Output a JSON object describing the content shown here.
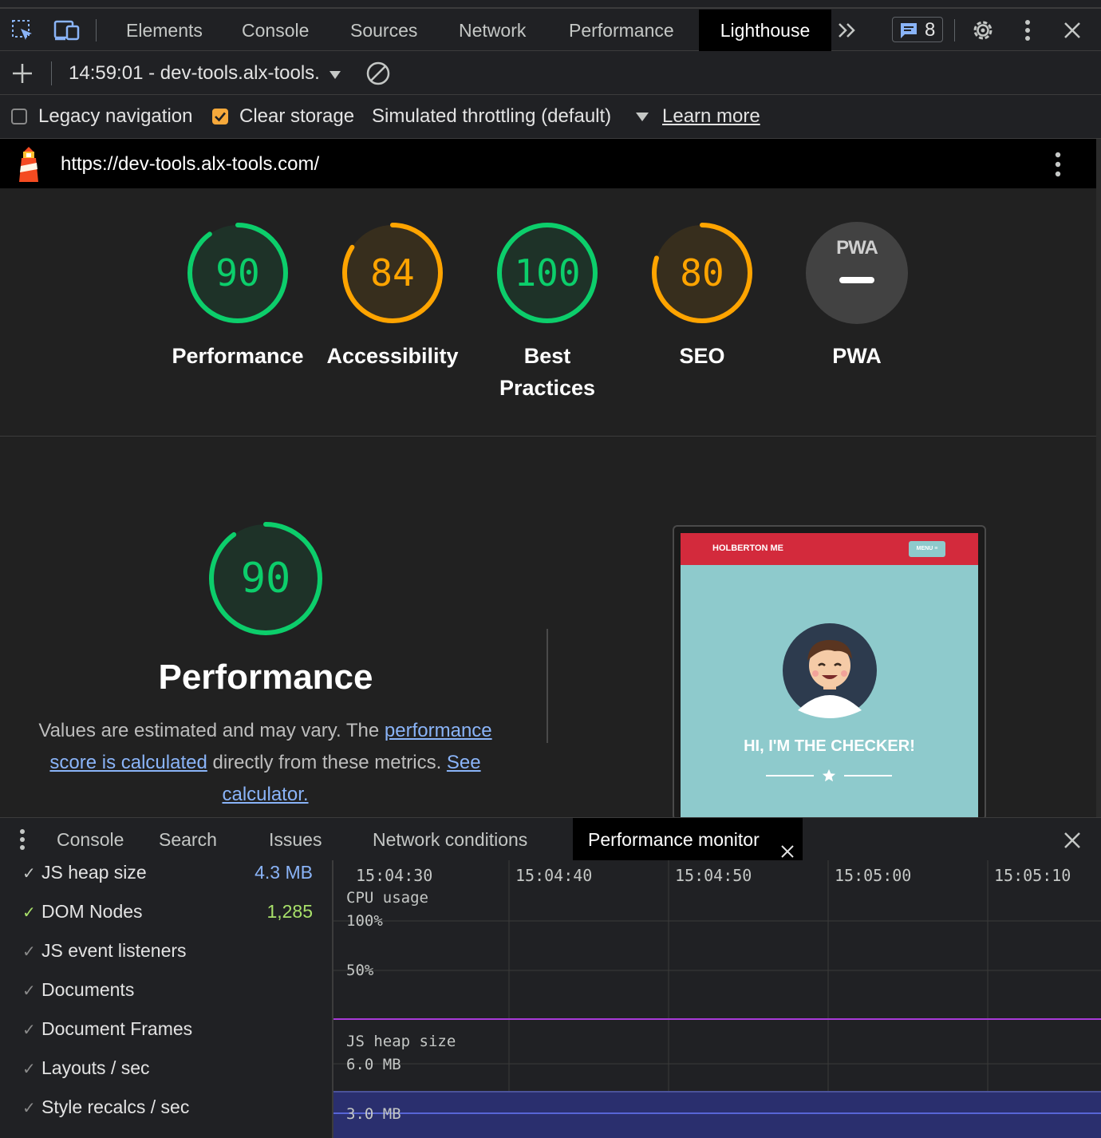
{
  "tabs": [
    "Elements",
    "Console",
    "Sources",
    "Network",
    "Performance",
    "Lighthouse"
  ],
  "active_tab": "Lighthouse",
  "issues_badge": "8",
  "session": {
    "report_select": "14:59:01 - dev-tools.alx-tools.",
    "add_icon": "plus-icon",
    "clear_icon": "clear-icon"
  },
  "options": {
    "legacy_navigation": {
      "label": "Legacy navigation",
      "checked": false
    },
    "clear_storage": {
      "label": "Clear storage",
      "checked": true
    },
    "throttling": "Simulated throttling (default)",
    "learn_more": "Learn more"
  },
  "url": "https://dev-tools.alx-tools.com/",
  "colors": {
    "pass": "#0cce6b",
    "average": "#ffa400",
    "accent": "#8ab4f8"
  },
  "scores": [
    {
      "value": "90",
      "label": "Performance",
      "rating": "pass",
      "fraction": 0.9
    },
    {
      "value": "84",
      "label": "Accessibility",
      "rating": "average",
      "fraction": 0.84
    },
    {
      "value": "100",
      "label": "Best Practices",
      "rating": "pass",
      "fraction": 1.0
    },
    {
      "value": "80",
      "label": "SEO",
      "rating": "average",
      "fraction": 0.8
    },
    {
      "value": "PWA",
      "label": "PWA",
      "rating": "na",
      "fraction": 0
    }
  ],
  "perf_section": {
    "score": "90",
    "score_fraction": 0.9,
    "title": "Performance",
    "desc_1": "Values are estimated and may vary. The ",
    "link_1": "performance score is calculated",
    "desc_2": " directly from these metrics. ",
    "link_2": "See calculator."
  },
  "screenshot": {
    "site_name": "HOLBERTON ME",
    "menu_label": "MENU ≡",
    "headline": "HI, I'M THE CHECKER!"
  },
  "drawer": {
    "tabs": [
      "Console",
      "Search",
      "Issues",
      "Network conditions",
      "Performance monitor"
    ],
    "active_tab": "Performance monitor",
    "metrics": [
      {
        "label": "JS heap size",
        "value": "4.3 MB",
        "enabled": true,
        "color": "#8ab4f8"
      },
      {
        "label": "DOM Nodes",
        "value": "1,285",
        "enabled": true,
        "color": "#a8e06a"
      },
      {
        "label": "JS event listeners",
        "value": "",
        "enabled": false
      },
      {
        "label": "Documents",
        "value": "",
        "enabled": false
      },
      {
        "label": "Document Frames",
        "value": "",
        "enabled": false
      },
      {
        "label": "Layouts / sec",
        "value": "",
        "enabled": false
      },
      {
        "label": "Style recalcs / sec",
        "value": "",
        "enabled": false
      }
    ],
    "times": [
      "15:04:30",
      "15:04:40",
      "15:04:50",
      "15:05:00",
      "15:05:10"
    ],
    "cpu": {
      "title": "CPU usage",
      "ticks": [
        "100%",
        "50%"
      ]
    },
    "heap": {
      "title": "JS heap size",
      "ticks": [
        "6.0 MB",
        "3.0 MB"
      ]
    }
  }
}
